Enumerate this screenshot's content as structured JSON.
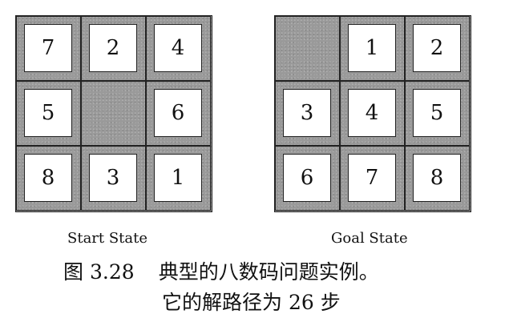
{
  "figure": {
    "start_label": "Start State",
    "goal_label": "Goal State",
    "caption_prefix": "图",
    "caption_number": "3.28",
    "caption_text": "典型的八数码问题实例。",
    "caption_line2": "它的解路径为 26 步"
  },
  "start_state": {
    "cells": [
      "7",
      "2",
      "4",
      "5",
      "",
      "6",
      "8",
      "3",
      "1"
    ]
  },
  "goal_state": {
    "cells": [
      "",
      "1",
      "2",
      "3",
      "4",
      "5",
      "6",
      "7",
      "8"
    ]
  },
  "colors": {
    "frame": "#9a9a9a",
    "tile": "#ffffff",
    "border": "#222222"
  }
}
